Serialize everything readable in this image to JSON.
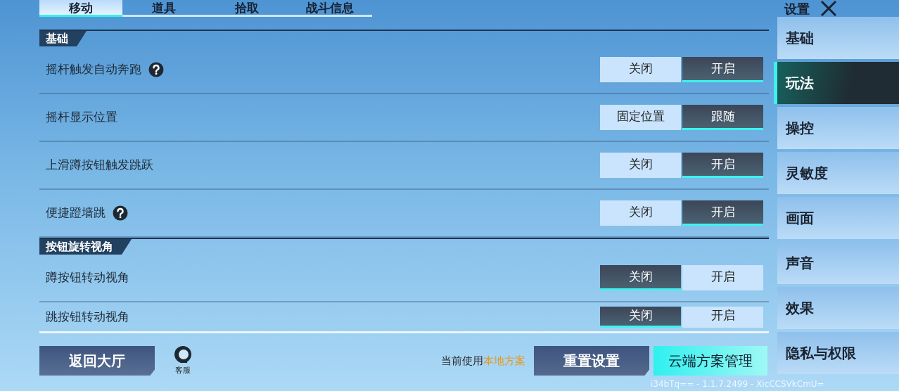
{
  "tabs": [
    {
      "label": "移动",
      "selected": true
    },
    {
      "label": "道具",
      "selected": false
    },
    {
      "label": "拾取",
      "selected": false
    },
    {
      "label": "战斗信息",
      "selected": false
    }
  ],
  "sections": [
    {
      "title": "基础",
      "rows": [
        {
          "label": "摇杆触发自动奔跑",
          "help": true,
          "options": [
            {
              "label": "关闭",
              "selected": false
            },
            {
              "label": "开启",
              "selected": true
            }
          ]
        },
        {
          "label": "摇杆显示位置",
          "help": false,
          "options": [
            {
              "label": "固定位置",
              "selected": false
            },
            {
              "label": "跟随",
              "selected": true
            }
          ]
        },
        {
          "label": "上滑蹲按钮触发跳跃",
          "help": false,
          "options": [
            {
              "label": "关闭",
              "selected": false
            },
            {
              "label": "开启",
              "selected": true
            }
          ]
        },
        {
          "label": "便捷蹬墙跳",
          "help": true,
          "options": [
            {
              "label": "关闭",
              "selected": false
            },
            {
              "label": "开启",
              "selected": true
            }
          ]
        }
      ]
    },
    {
      "title": "按钮旋转视角",
      "rows": [
        {
          "label": "蹲按钮转动视角",
          "help": false,
          "options": [
            {
              "label": "关闭",
              "selected": true
            },
            {
              "label": "开启",
              "selected": false
            }
          ]
        },
        {
          "label": "跳按钮转动视角",
          "help": false,
          "options": [
            {
              "label": "关闭",
              "selected": true
            },
            {
              "label": "开启",
              "selected": false
            }
          ]
        }
      ]
    }
  ],
  "footer": {
    "back_button": "返回大厅",
    "support": "客服",
    "plan_prefix": "当前使用",
    "plan_name": "本地方案",
    "reset_button": "重置设置",
    "cloud_button": "云端方案管理",
    "version": "i34bTq== - 1.1.7.2499 - XicCCSVkCmU="
  },
  "sidebar": {
    "title": "设置",
    "items": [
      {
        "label": "基础",
        "selected": false
      },
      {
        "label": "玩法",
        "selected": true
      },
      {
        "label": "操控",
        "selected": false
      },
      {
        "label": "灵敏度",
        "selected": false
      },
      {
        "label": "画面",
        "selected": false
      },
      {
        "label": "声音",
        "selected": false
      },
      {
        "label": "效果",
        "selected": false
      },
      {
        "label": "隐私与权限",
        "selected": false
      }
    ]
  }
}
